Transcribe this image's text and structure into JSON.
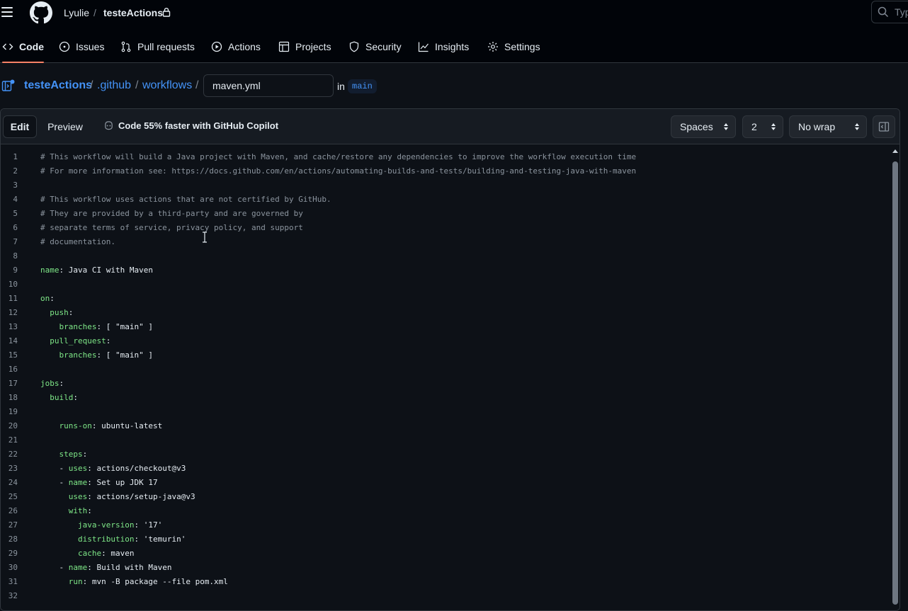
{
  "header": {
    "owner": "Lyulie",
    "separator": "/",
    "repo": "testeActions",
    "search_placeholder": "Typ"
  },
  "reponav": {
    "items": [
      {
        "label": "Code",
        "icon": "code-icon",
        "active": true
      },
      {
        "label": "Issues",
        "icon": "issue-opened-icon"
      },
      {
        "label": "Pull requests",
        "icon": "git-pull-request-icon"
      },
      {
        "label": "Actions",
        "icon": "play-icon"
      },
      {
        "label": "Projects",
        "icon": "table-icon"
      },
      {
        "label": "Security",
        "icon": "shield-icon"
      },
      {
        "label": "Insights",
        "icon": "graph-icon"
      },
      {
        "label": "Settings",
        "icon": "gear-icon"
      }
    ]
  },
  "breadcrumb": {
    "repo": "testeActions",
    "dir1": ".github",
    "dir2": "workflows",
    "sep": "/",
    "filename": "maven.yml",
    "in_label": "in",
    "branch": "main"
  },
  "editor": {
    "tab_edit": "Edit",
    "tab_preview": "Preview",
    "copilot_text": "Code 55% faster with GitHub Copilot",
    "indent_mode": "Spaces",
    "indent_size": "2",
    "wrap_mode": "No wrap",
    "colors": {
      "key": "#7ee787",
      "comment": "#8b949e",
      "value": "#a5d6ff",
      "link": "#4493f8",
      "active_tab": "#f78166"
    },
    "lines": [
      {
        "n": "1",
        "indent": "",
        "comment": "# This workflow will build a Java project with Maven, and cache/restore any dependencies to improve the workflow execution time"
      },
      {
        "n": "2",
        "indent": "",
        "comment": "# For more information see: https://docs.github.com/en/actions/automating-builds-and-tests/building-and-testing-java-with-maven"
      },
      {
        "n": "3",
        "indent": ""
      },
      {
        "n": "4",
        "indent": "",
        "comment": "# This workflow uses actions that are not certified by GitHub."
      },
      {
        "n": "5",
        "indent": "",
        "comment": "# They are provided by a third-party and are governed by"
      },
      {
        "n": "6",
        "indent": "",
        "comment": "# separate terms of service, privacy policy, and support"
      },
      {
        "n": "7",
        "indent": "",
        "comment": "# documentation."
      },
      {
        "n": "8",
        "indent": ""
      },
      {
        "n": "9",
        "indent": "",
        "key": "name",
        "value": " Java CI with Maven"
      },
      {
        "n": "10",
        "indent": ""
      },
      {
        "n": "11",
        "indent": "",
        "key": "on",
        "value": ""
      },
      {
        "n": "12",
        "indent": "  ",
        "key": "push",
        "value": ""
      },
      {
        "n": "13",
        "indent": "    ",
        "key": "branches",
        "value": " [ \"main\" ]"
      },
      {
        "n": "14",
        "indent": "  ",
        "key": "pull_request",
        "value": ""
      },
      {
        "n": "15",
        "indent": "    ",
        "key": "branches",
        "value": " [ \"main\" ]"
      },
      {
        "n": "16",
        "indent": ""
      },
      {
        "n": "17",
        "indent": "",
        "key": "jobs",
        "value": ""
      },
      {
        "n": "18",
        "indent": "  ",
        "key": "build",
        "value": ""
      },
      {
        "n": "19",
        "indent": ""
      },
      {
        "n": "20",
        "indent": "    ",
        "key": "runs-on",
        "value": " ubuntu-latest"
      },
      {
        "n": "21",
        "indent": ""
      },
      {
        "n": "22",
        "indent": "    ",
        "key": "steps",
        "value": ""
      },
      {
        "n": "23",
        "indent": "    ",
        "dash": "- ",
        "key": "uses",
        "value": " actions/checkout@v3"
      },
      {
        "n": "24",
        "indent": "    ",
        "dash": "- ",
        "key": "name",
        "value": " Set up JDK 17"
      },
      {
        "n": "25",
        "indent": "      ",
        "key": "uses",
        "value": " actions/setup-java@v3"
      },
      {
        "n": "26",
        "indent": "      ",
        "key": "with",
        "value": ""
      },
      {
        "n": "27",
        "indent": "        ",
        "key": "java-version",
        "value": " '17'"
      },
      {
        "n": "28",
        "indent": "        ",
        "key": "distribution",
        "value": " 'temurin'"
      },
      {
        "n": "29",
        "indent": "        ",
        "key": "cache",
        "value": " maven"
      },
      {
        "n": "30",
        "indent": "    ",
        "dash": "- ",
        "key": "name",
        "value": " Build with Maven"
      },
      {
        "n": "31",
        "indent": "      ",
        "key": "run",
        "value": " mvn -B package --file pom.xml"
      },
      {
        "n": "32",
        "indent": ""
      }
    ]
  }
}
